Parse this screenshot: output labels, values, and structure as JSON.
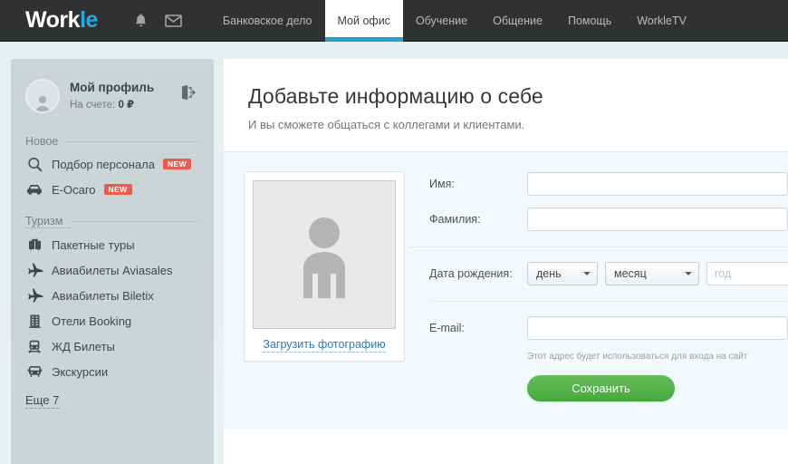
{
  "colors": {
    "topbar_bg": "#2f3133",
    "accent_blue": "#27a9e1",
    "active_tab_underline": "#2a9fc6",
    "sidebar_bg": "#ccd4d6",
    "page_bg": "#e8eff0",
    "form_bg": "#f3f8fc",
    "badge_red": "#ec5b50",
    "save_green": "#44a93d",
    "link_blue": "#2a7bb5"
  },
  "topbar": {
    "logo_main": "Work",
    "logo_accent": "le",
    "icons": [
      {
        "name": "bell-icon",
        "label": "Уведомления"
      },
      {
        "name": "envelope-icon",
        "label": "Сообщения"
      }
    ],
    "nav": [
      {
        "label": "Банковское дело",
        "active": false
      },
      {
        "label": "Мой офис",
        "active": true
      },
      {
        "label": "Обучение",
        "active": false
      },
      {
        "label": "Общение",
        "active": false
      },
      {
        "label": "Помощь",
        "active": false
      },
      {
        "label": "WorkleTV",
        "active": false
      }
    ]
  },
  "sidebar": {
    "profile": {
      "name": "Мой профиль",
      "balance_label": "На счете:",
      "balance_value": "0 ₽",
      "logout_icon": "logout-icon"
    },
    "sections": [
      {
        "title": "Новое",
        "title_is_link": false,
        "items": [
          {
            "label": "Подбор персонала",
            "icon": "magnifier-icon",
            "badge": "NEW"
          },
          {
            "label": "E-Осаго",
            "icon": "car-icon",
            "badge": "NEW"
          }
        ]
      },
      {
        "title": "Туризм",
        "title_is_link": true,
        "items": [
          {
            "label": "Пакетные туры",
            "icon": "suitcase-icon",
            "badge": ""
          },
          {
            "label": "Авиабилеты Aviasales",
            "icon": "plane-icon",
            "badge": ""
          },
          {
            "label": "Авиабилеты Biletix",
            "icon": "plane-icon",
            "badge": ""
          },
          {
            "label": "Отели Booking",
            "icon": "building-icon",
            "badge": ""
          },
          {
            "label": "ЖД Билеты",
            "icon": "train-icon",
            "badge": ""
          },
          {
            "label": "Экскурсии",
            "icon": "bus-icon",
            "badge": ""
          }
        ],
        "more_link": "Еще 7"
      }
    ]
  },
  "main": {
    "title": "Добавьте информацию о себе",
    "subtitle": "И вы сможете общаться с коллегами и клиентами.",
    "photo": {
      "placeholder_icon": "person-silhouette-icon",
      "upload_link": "Загрузить фотографию"
    },
    "form": {
      "first_name": {
        "label": "Имя:",
        "value": "",
        "placeholder": ""
      },
      "last_name": {
        "label": "Фамилия:",
        "value": "",
        "placeholder": ""
      },
      "birth_date": {
        "label": "Дата рождения:",
        "day": {
          "selected": "день"
        },
        "month": {
          "selected": "месяц"
        },
        "year": {
          "value": "",
          "placeholder": "год"
        }
      },
      "email": {
        "label": "E-mail:",
        "value": "",
        "placeholder": "",
        "hint": "Этот адрес будет использоваться для входа на сайт"
      },
      "save_label": "Сохранить"
    }
  }
}
